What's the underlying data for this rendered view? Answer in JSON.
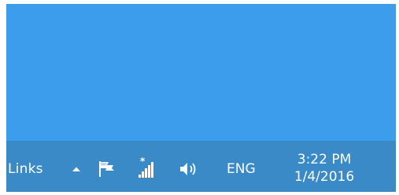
{
  "colors": {
    "desktop": "#3d9ded",
    "taskbar": "#3b8ac8",
    "text": "#ffffff"
  },
  "taskbar": {
    "toolbar_label": "Links",
    "tray": {
      "overflow_icon": "chevron-up-icon",
      "icons": [
        "flag-icon",
        "network-icon",
        "volume-icon"
      ],
      "language": "ENG"
    },
    "clock": {
      "time": "3:22 PM",
      "date": "1/4/2016"
    }
  }
}
